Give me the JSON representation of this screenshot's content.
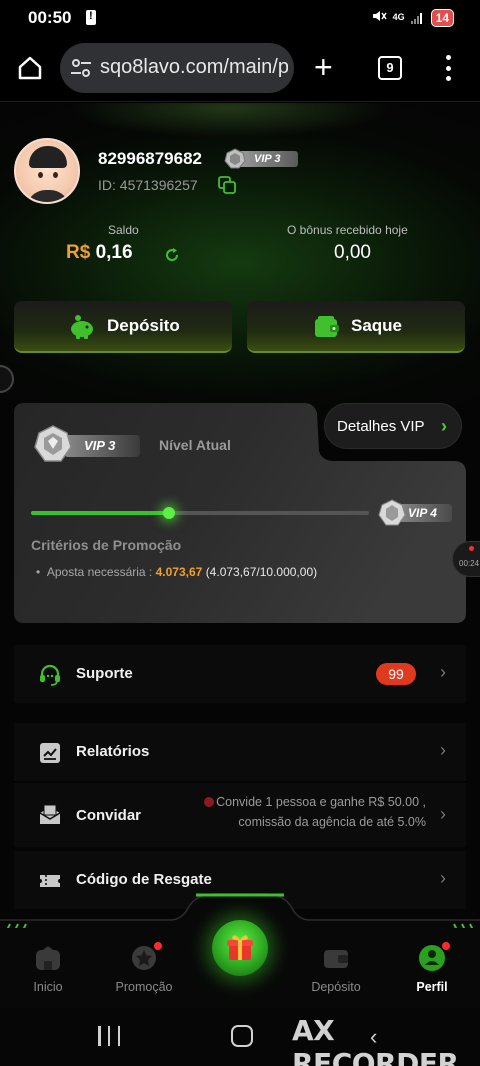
{
  "status_bar": {
    "time": "00:50",
    "network": "4G",
    "battery": "14"
  },
  "browser": {
    "url": "sqo8lavo.com/main/p",
    "tab_count": "9"
  },
  "profile": {
    "user_id": "82996879682",
    "vip_badge": "VIP 3",
    "id_line": "ID: 4571396257"
  },
  "balance": {
    "label": "Saldo",
    "currency": "R$",
    "amount": "0,16",
    "bonus_label": "O bônus recebido hoje",
    "bonus_value": "0,00"
  },
  "actions": {
    "deposit_label": "Depósito",
    "withdraw_label": "Saque"
  },
  "vip_card": {
    "current_level": "VIP 3",
    "level_label": "Nível Atual",
    "details_label": "Detalhes VIP",
    "next_level": "VIP 4",
    "progress_fraction": 0.4074,
    "criteria_title": "Critérios de Promoção",
    "criteria_label": "Aposta necessária :",
    "criteria_current": "4.073,67",
    "criteria_progress": "(4.073,67/10.000,00)"
  },
  "side_recorder": {
    "time": "00:24"
  },
  "menu": {
    "support_label": "Suporte",
    "support_badge": "99",
    "reports_label": "Relatórios",
    "invite_label": "Convidar",
    "invite_note_line1": "Convide 1 pessoa e ganhe R$ 50.00 ,",
    "invite_note_line2": "comissão da agência de até 5.0%",
    "redeem_label": "Código de Resgate"
  },
  "bottom_nav": {
    "home_label": "Inicio",
    "promo_label": "Promoção",
    "deposit_label": "Depósito",
    "profile_label": "Perfil"
  },
  "watermark": "AX RECORDER",
  "colors": {
    "accent_green": "#36c22a",
    "currency_orange": "#f0a030",
    "badge_red": "#e03a1e"
  }
}
